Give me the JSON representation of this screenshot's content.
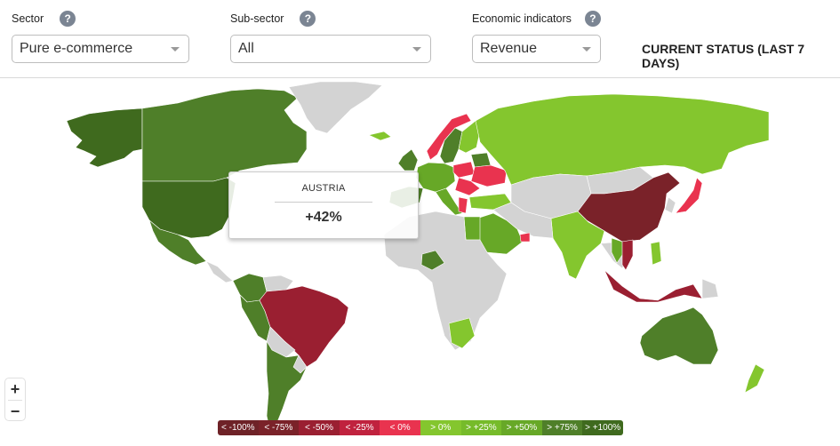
{
  "filters": {
    "sector": {
      "label": "Sector",
      "value": "Pure e-commerce",
      "help": "?"
    },
    "subsector": {
      "label": "Sub-sector",
      "value": "All",
      "help": "?"
    },
    "indicator": {
      "label": "Economic indicators",
      "value": "Revenue",
      "help": "?"
    }
  },
  "status_title": "CURRENT STATUS (LAST 7 DAYS)",
  "tooltip": {
    "country": "AUSTRIA",
    "value": "+42%"
  },
  "zoom": {
    "in": "+",
    "out": "−"
  },
  "colors": {
    "no_data": "#d3d3d3",
    "lt_minus100": "#6e2227",
    "lt_minus75": "#7a2229",
    "lt_minus50": "#9a1f31",
    "lt_minus25": "#c0223e",
    "lt_0": "#e9334f",
    "gt_0": "#84c62e",
    "gt_25": "#76bb2a",
    "gt_50": "#67a827",
    "gt_75": "#4f7f29",
    "gt_100": "#3f6a1e"
  },
  "legend": [
    {
      "label": "< -100%",
      "color": "#6e2227"
    },
    {
      "label": "< -75%",
      "color": "#7a2229"
    },
    {
      "label": "< -50%",
      "color": "#9a1f31"
    },
    {
      "label": "< -25%",
      "color": "#c0223e"
    },
    {
      "label": "< 0%",
      "color": "#e9334f"
    },
    {
      "label": "> 0%",
      "color": "#84c62e"
    },
    {
      "label": "> +25%",
      "color": "#76bb2a"
    },
    {
      "label": "> +50%",
      "color": "#67a827"
    },
    {
      "label": "> +75%",
      "color": "#4f7f29"
    },
    {
      "label": "> +100%",
      "color": "#3f6a1e"
    }
  ],
  "regions": [
    {
      "name": "alaska",
      "bucket": "gt_100"
    },
    {
      "name": "canada",
      "bucket": "gt_75"
    },
    {
      "name": "usa",
      "bucket": "gt_100"
    },
    {
      "name": "mexico",
      "bucket": "gt_75"
    },
    {
      "name": "greenland",
      "bucket": "no_data"
    },
    {
      "name": "iceland",
      "bucket": "gt_0"
    },
    {
      "name": "central-america",
      "bucket": "no_data"
    },
    {
      "name": "colombia",
      "bucket": "gt_75"
    },
    {
      "name": "venezuela",
      "bucket": "no_data"
    },
    {
      "name": "peru",
      "bucket": "gt_75"
    },
    {
      "name": "brazil",
      "bucket": "lt_minus50"
    },
    {
      "name": "bolivia",
      "bucket": "no_data"
    },
    {
      "name": "chile-argentina",
      "bucket": "gt_75"
    },
    {
      "name": "uruguay",
      "bucket": "no_data"
    },
    {
      "name": "uk-ireland",
      "bucket": "gt_75"
    },
    {
      "name": "norway",
      "bucket": "lt_0"
    },
    {
      "name": "sweden",
      "bucket": "gt_75"
    },
    {
      "name": "finland",
      "bucket": "gt_0"
    },
    {
      "name": "western-europe",
      "bucket": "gt_50"
    },
    {
      "name": "spain-portugal",
      "bucket": "gt_75"
    },
    {
      "name": "italy",
      "bucket": "gt_50"
    },
    {
      "name": "poland",
      "bucket": "lt_0"
    },
    {
      "name": "belarus",
      "bucket": "gt_75"
    },
    {
      "name": "ukraine",
      "bucket": "lt_0"
    },
    {
      "name": "romania",
      "bucket": "lt_0"
    },
    {
      "name": "greece",
      "bucket": "lt_0"
    },
    {
      "name": "russia",
      "bucket": "gt_0"
    },
    {
      "name": "turkey",
      "bucket": "gt_0"
    },
    {
      "name": "kazakhstan-central-asia",
      "bucket": "no_data"
    },
    {
      "name": "mongolia",
      "bucket": "no_data"
    },
    {
      "name": "china",
      "bucket": "lt_minus75"
    },
    {
      "name": "japan",
      "bucket": "lt_0"
    },
    {
      "name": "korea",
      "bucket": "no_data"
    },
    {
      "name": "india",
      "bucket": "gt_0"
    },
    {
      "name": "middle-east",
      "bucket": "no_data"
    },
    {
      "name": "saudi-arabia",
      "bucket": "gt_50"
    },
    {
      "name": "egypt",
      "bucket": "gt_50"
    },
    {
      "name": "uae",
      "bucket": "lt_0"
    },
    {
      "name": "africa",
      "bucket": "no_data"
    },
    {
      "name": "nigeria",
      "bucket": "gt_75"
    },
    {
      "name": "south-africa",
      "bucket": "gt_0"
    },
    {
      "name": "southeast-asia",
      "bucket": "no_data"
    },
    {
      "name": "thailand",
      "bucket": "gt_50"
    },
    {
      "name": "vietnam",
      "bucket": "lt_minus50"
    },
    {
      "name": "philippines",
      "bucket": "gt_0"
    },
    {
      "name": "indonesia",
      "bucket": "lt_minus50"
    },
    {
      "name": "papua-new-guinea",
      "bucket": "no_data"
    },
    {
      "name": "australia",
      "bucket": "gt_75"
    },
    {
      "name": "new-zealand",
      "bucket": "gt_0"
    }
  ]
}
